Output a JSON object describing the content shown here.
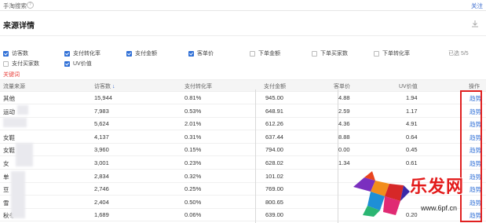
{
  "topbar": {
    "title": "手淘搜索",
    "help_icon": "?",
    "follow": "关注"
  },
  "section": {
    "title": "来源详情",
    "download_icon": "download-icon"
  },
  "metrics": {
    "row1": [
      {
        "label": "访客数",
        "checked": true
      },
      {
        "label": "支付转化率",
        "checked": true
      },
      {
        "label": "支付金额",
        "checked": true
      },
      {
        "label": "客单价",
        "checked": true
      },
      {
        "label": "下单金额",
        "checked": false
      },
      {
        "label": "下单买家数",
        "checked": false
      },
      {
        "label": "下单转化率",
        "checked": false
      }
    ],
    "row2": [
      {
        "label": "支付买家数",
        "checked": false
      },
      {
        "label": "UV价值",
        "checked": true
      }
    ],
    "selected_count": "已选 5/5"
  },
  "keyword_link": "关键词",
  "table": {
    "headers": {
      "source": "流量来源",
      "visitors": "访客数",
      "conversion": "支付转化率",
      "amount": "支付金额",
      "unit_price": "客单价",
      "uv_value": "UV价值",
      "action": "操作"
    },
    "sort_icon": "↓",
    "rows": [
      {
        "source": "其他",
        "visitors": "15,944",
        "conversion": "0.81%",
        "amount": "945.00",
        "unit_price": "4.88",
        "uv_value": "1.94",
        "action": "趋势"
      },
      {
        "source": "运动",
        "visitors": "7,983",
        "conversion": "0.53%",
        "amount": "648.91",
        "unit_price": "2.59",
        "uv_value": "1.17",
        "action": "趋势"
      },
      {
        "source": "",
        "visitors": "5,624",
        "conversion": "2.01%",
        "amount": "612.26",
        "unit_price": "4.36",
        "uv_value": "4.91",
        "action": "趋势"
      },
      {
        "source": "女鞋",
        "visitors": "4,137",
        "conversion": "0.31%",
        "amount": "637.44",
        "unit_price": "8.88",
        "uv_value": "0.64",
        "action": "趋势"
      },
      {
        "source": "女鞋",
        "visitors": "3,960",
        "conversion": "0.15%",
        "amount": "794.00",
        "unit_price": "0.00",
        "uv_value": "0.45",
        "action": "趋势"
      },
      {
        "source": "女",
        "visitors": "3,001",
        "conversion": "0.23%",
        "amount": "628.02",
        "unit_price": "1.34",
        "uv_value": "0.61",
        "action": "趋势"
      },
      {
        "source": "单",
        "visitors": "2,834",
        "conversion": "0.32%",
        "amount": "101.02",
        "unit_price": "",
        "uv_value": "",
        "action": "趋势"
      },
      {
        "source": "豆",
        "visitors": "2,746",
        "conversion": "0.25%",
        "amount": "769.00",
        "unit_price": "",
        "uv_value": "",
        "action": "趋势"
      },
      {
        "source": "雪",
        "visitors": "2,404",
        "conversion": "0.50%",
        "amount": "800.65",
        "unit_price": "",
        "uv_value": "",
        "action": "趋势"
      },
      {
        "source": "秋冬",
        "visitors": "1,689",
        "conversion": "0.06%",
        "amount": "639.00",
        "unit_price": "",
        "uv_value": "0.20",
        "action": "趋势"
      }
    ]
  },
  "watermark": {
    "text": "乐发网",
    "url": "www.6pf.cn"
  }
}
